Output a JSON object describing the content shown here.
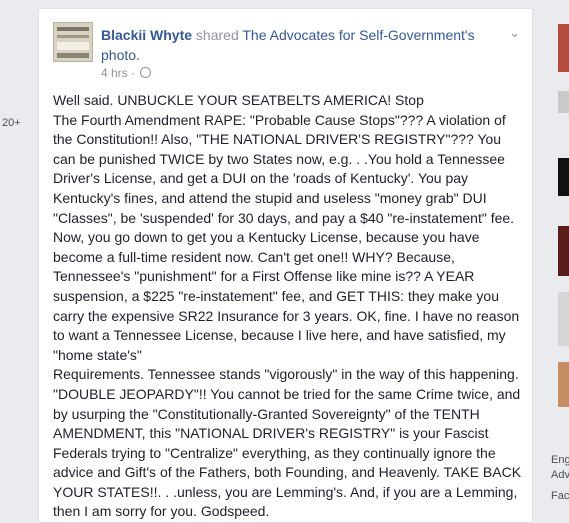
{
  "sidebar": {
    "count_badge": "20+"
  },
  "post": {
    "author": "Blackii Whyte",
    "shared_text": "shared",
    "page_link": "The Advocates for Self-Government's",
    "object_link": "photo.",
    "timestamp": "4 hrs",
    "separator": "·",
    "menu_icon": "chevron-down-icon",
    "privacy_icon": "globe-icon",
    "body_paragraphs": [
      "Well said. UNBUCKLE YOUR SEATBELTS AMERICA! Stop",
      "The Fourth Amendment RAPE: \"Probable Cause Stops\"??? A violation of the Constitution!! Also, \"THE NATIONAL DRIVER'S REGISTRY\"??? You can be punished TWICE by two States now, e.g. . .You hold a Tennessee Driver's License, and get a DUI on the 'roads of Kentucky'. You pay Kentucky's fines, and attend the stupid and useless \"money grab\" DUI \"Classes\", be 'suspended' for 30 days, and pay a $40 \"re-instatement\" fee. Now, you go down to get you a Kentucky License, because you have become a full-time resident now. Can't get one!! WHY? Because, Tennessee's \"punishment\" for a First Offense like mine is?? A YEAR suspension, a $225 \"re-instatement\" fee, and GET THIS: they make you carry the expensive SR22 Insurance for 3 years. OK, fine. I have no reason to want a Tennessee License, because I live here, and have satisfied, my \"home state's\"",
      "Requirements. Tennessee stands \"vigorously\" in the way of this happening. \"DOUBLE JEOPARDY\"!! You cannot be tried for the same Crime twice, and by usurping the \"Constitutionally-Granted Sovereignty\" of the TENTH AMENDMENT, this \"NATIONAL DRIVER's REGISTRY\" is your Fascist Federals trying to \"Centralize\" everything, as they continually ignore the advice and Gift's of the Fathers, both Founding, and Heavenly. TAKE BACK YOUR STATES!!. . .unless, you are Lemming's. And, if you are a Lemming, then I am sorry for you. Godspeed."
    ]
  },
  "right_rail": {
    "text_1": "Eng",
    "text_2": "Adv",
    "text_3": "Fac"
  }
}
